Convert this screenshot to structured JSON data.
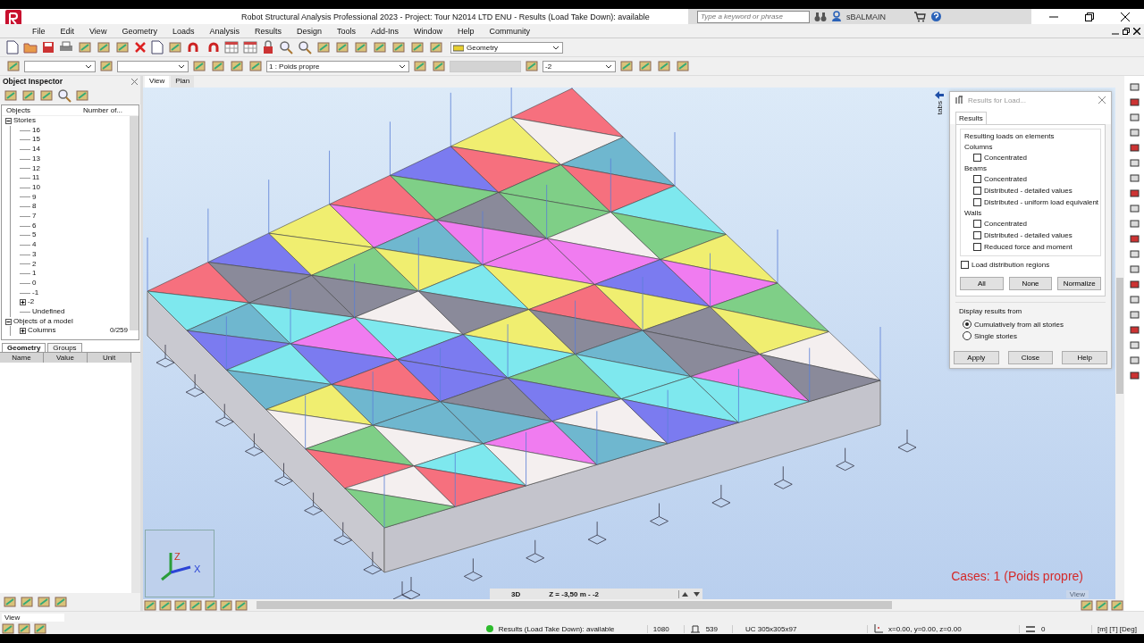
{
  "window": {
    "title": "Robot Structural Analysis Professional 2023 - Project: Tour N2014 LTD ENU - Results (Load Take Down): available",
    "search_placeholder": "Type a keyword or phrase",
    "user": "sBALMAIN"
  },
  "menu": [
    "File",
    "Edit",
    "View",
    "Geometry",
    "Loads",
    "Analysis",
    "Results",
    "Design",
    "Tools",
    "Add-Ins",
    "Window",
    "Help",
    "Community"
  ],
  "toolbar": {
    "layout": "Geometry",
    "load_case": "1 : Poids propre",
    "story": "-2"
  },
  "object_inspector": {
    "title": "Object Inspector",
    "columns": [
      "Objects",
      "Number of..."
    ],
    "tree": [
      {
        "label": "Stories",
        "expanded": true,
        "children": [
          {
            "label": "16"
          },
          {
            "label": "15"
          },
          {
            "label": "14"
          },
          {
            "label": "13"
          },
          {
            "label": "12"
          },
          {
            "label": "11"
          },
          {
            "label": "10"
          },
          {
            "label": "9"
          },
          {
            "label": "8"
          },
          {
            "label": "7"
          },
          {
            "label": "6"
          },
          {
            "label": "5"
          },
          {
            "label": "4"
          },
          {
            "label": "3"
          },
          {
            "label": "2"
          },
          {
            "label": "1"
          },
          {
            "label": "0"
          },
          {
            "label": "-1"
          },
          {
            "label": "-2",
            "expanded": false
          },
          {
            "label": "Undefined"
          }
        ]
      },
      {
        "label": "Objects of a model",
        "expanded": true,
        "children": [
          {
            "label": "Columns",
            "count": "0/259",
            "expanded": false
          }
        ]
      }
    ],
    "tabs": [
      {
        "label": "Geometry",
        "selected": true
      },
      {
        "label": "Groups",
        "selected": false
      }
    ],
    "properties_columns": [
      "Name",
      "Value",
      "Unit"
    ]
  },
  "view": {
    "tabs": [
      {
        "label": "View",
        "selected": true
      },
      {
        "label": "Plan",
        "selected": false
      }
    ],
    "axis_labels": [
      "Z",
      "X"
    ],
    "mode": "3D",
    "z_level": "Z = -3,50 m - -2",
    "cases": "Cases: 1 (Poids propre)",
    "corner_label": "View"
  },
  "side_tab": "tabs",
  "dialog": {
    "title": "Results for Load...",
    "tab": "Results",
    "group_title": "Resulting loads on elements",
    "sections": [
      {
        "label": "Columns",
        "options": [
          {
            "label": "Concentrated",
            "checked": false
          }
        ]
      },
      {
        "label": "Beams",
        "options": [
          {
            "label": "Concentrated",
            "checked": false
          },
          {
            "label": "Distributed - detailed values",
            "checked": false
          },
          {
            "label": "Distributed - uniform load equivalent",
            "checked": false
          }
        ]
      },
      {
        "label": "Walls",
        "options": [
          {
            "label": "Concentrated",
            "checked": false
          },
          {
            "label": "Distributed - detailed values",
            "checked": false
          },
          {
            "label": "Reduced force and moment",
            "checked": false
          }
        ]
      }
    ],
    "regions": {
      "label": "Load distribution regions",
      "checked": false
    },
    "buttons": [
      "All",
      "None",
      "Normalize"
    ],
    "display_title": "Display results from",
    "display_options": [
      {
        "label": "Cumulatively from all stories",
        "selected": true
      },
      {
        "label": "Single stories",
        "selected": false
      }
    ],
    "footer_buttons": [
      "Apply",
      "Close",
      "Help"
    ]
  },
  "command_line": "View",
  "status_bar": {
    "message": "Results (Load Take Down): available",
    "nodes": "1080",
    "bars": "539",
    "section": "UC 305x305x97",
    "coordinates": "x=0.00, y=0.00, z=0.00",
    "count": "0",
    "units": "[m] [T] [Deg]"
  }
}
